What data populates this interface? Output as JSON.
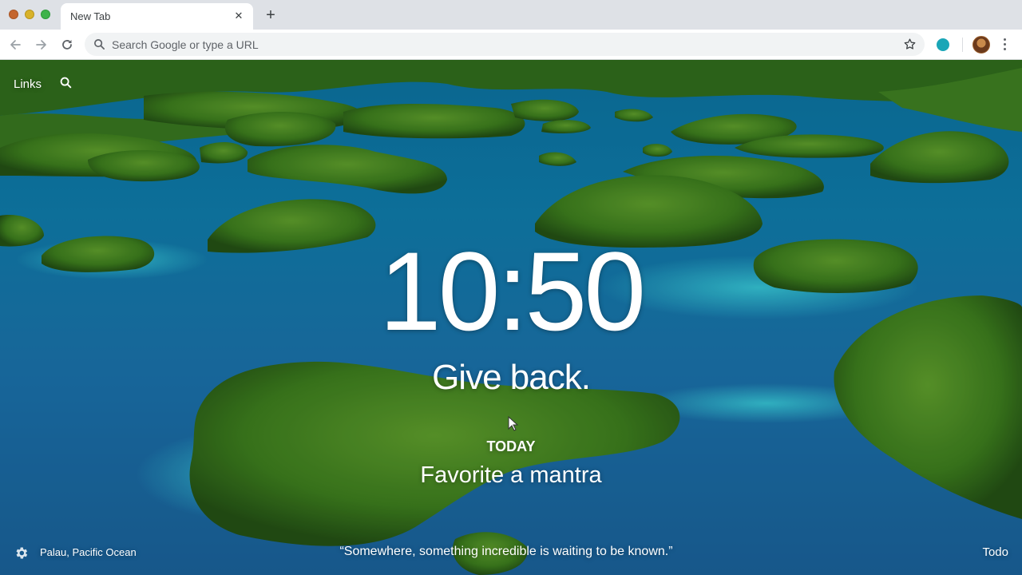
{
  "browser": {
    "tab_title": "New Tab",
    "tab_close": "✕",
    "new_tab": "+",
    "omnibox_placeholder": "Search Google or type a URL"
  },
  "momentum": {
    "links_label": "Links",
    "clock": "10:50",
    "mantra": "Give back.",
    "focus_label": "TODAY",
    "focus_text": "Favorite a mantra",
    "location": "Palau, Pacific Ocean",
    "quote": "“Somewhere, something incredible is waiting to be known.”",
    "todo_label": "Todo"
  },
  "icons": {
    "back": "arrow-left-icon",
    "forward": "arrow-right-icon",
    "reload": "reload-icon",
    "search": "search-icon",
    "star": "star-icon",
    "settings": "gear-icon",
    "menu": "kebab-menu-icon"
  },
  "colors": {
    "chrome_bg": "#dee1e6",
    "omnibox_bg": "#f1f3f4",
    "water": "#0f79a6",
    "island": "#3f7f1f",
    "lagoon": "#2fb6c9",
    "overlay_text": "#ffffff"
  }
}
